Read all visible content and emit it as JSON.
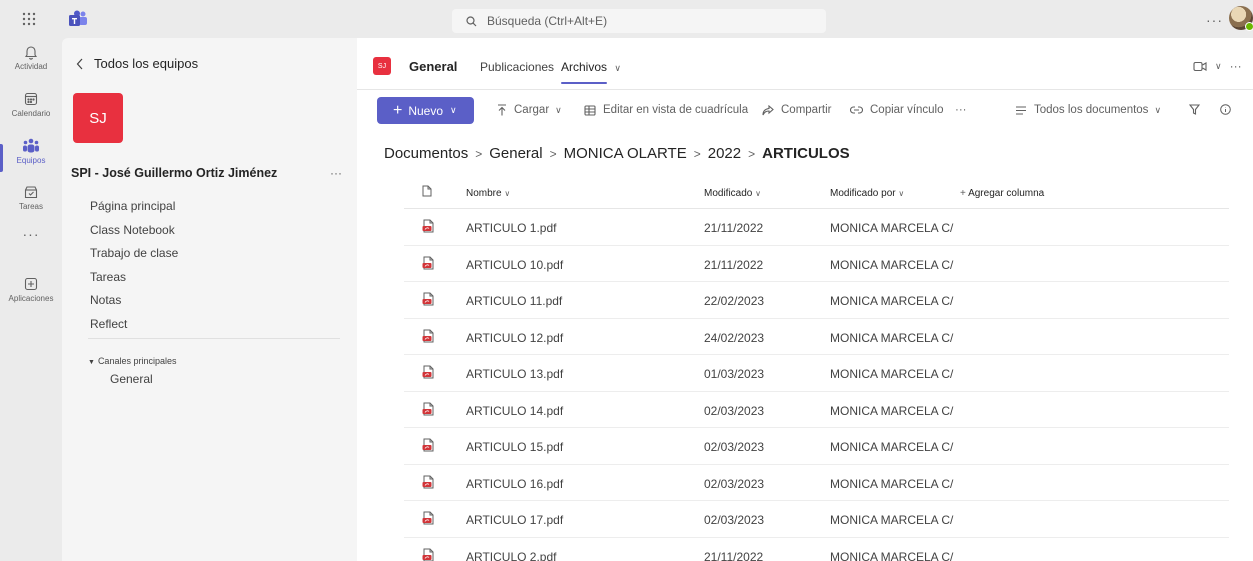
{
  "search": {
    "placeholder": "Búsqueda (Ctrl+Alt+E)"
  },
  "topbar": {
    "more": "···"
  },
  "rail": {
    "items": [
      {
        "label": "Actividad",
        "icon": "bell-icon"
      },
      {
        "label": "Calendario",
        "icon": "calendar-icon"
      },
      {
        "label": "Equipos",
        "icon": "teams-icon"
      },
      {
        "label": "Tareas",
        "icon": "tasks-icon"
      },
      {
        "label": "",
        "icon": "more-icon",
        "glyph": "···"
      },
      {
        "label": "Aplicaciones",
        "icon": "add-apps-icon"
      }
    ]
  },
  "team": {
    "back_label": "Todos los equipos",
    "tile_initials": "SJ",
    "name": "SPI - José Guillermo Ortiz Jiménez",
    "more": "···",
    "nav": [
      "Página principal",
      "Class Notebook",
      "Trabajo de clase",
      "Tareas",
      "Notas",
      "Reflect"
    ],
    "channels_heading": "Canales principales",
    "channels": [
      "General"
    ]
  },
  "channel": {
    "tile_initials": "SJ",
    "name": "General",
    "tabs": [
      "Publicaciones",
      "Archivos"
    ],
    "active_tab": "Archivos",
    "more": "···"
  },
  "toolbar": {
    "new_label": "Nuevo",
    "upload_label": "Cargar",
    "grid_label": "Editar en vista de cuadrícula",
    "share_label": "Compartir",
    "copy_link_label": "Copiar vínculo",
    "more": "···",
    "view_label": "Todos los documentos"
  },
  "breadcrumb": [
    "Documentos",
    "General",
    "MONICA OLARTE",
    "2022",
    "ARTICULOS"
  ],
  "table": {
    "columns": {
      "name": "Nombre",
      "modified": "Modificado",
      "modified_by": "Modificado por",
      "add_column": "Agregar columna"
    },
    "rows": [
      {
        "name": "ARTICULO 1.pdf",
        "modified": "21/11/2022",
        "modified_by": "MONICA MARCELA C/"
      },
      {
        "name": "ARTICULO 10.pdf",
        "modified": "21/11/2022",
        "modified_by": "MONICA MARCELA C/"
      },
      {
        "name": "ARTICULO 11.pdf",
        "modified": "22/02/2023",
        "modified_by": "MONICA MARCELA C/"
      },
      {
        "name": "ARTICULO 12.pdf",
        "modified": "24/02/2023",
        "modified_by": "MONICA MARCELA C/"
      },
      {
        "name": "ARTICULO 13.pdf",
        "modified": "01/03/2023",
        "modified_by": "MONICA MARCELA C/"
      },
      {
        "name": "ARTICULO 14.pdf",
        "modified": "02/03/2023",
        "modified_by": "MONICA MARCELA C/"
      },
      {
        "name": "ARTICULO 15.pdf",
        "modified": "02/03/2023",
        "modified_by": "MONICA MARCELA C/"
      },
      {
        "name": "ARTICULO 16.pdf",
        "modified": "02/03/2023",
        "modified_by": "MONICA MARCELA C/"
      },
      {
        "name": "ARTICULO 17.pdf",
        "modified": "02/03/2023",
        "modified_by": "MONICA MARCELA C/"
      },
      {
        "name": "ARTICULO 2.pdf",
        "modified": "21/11/2022",
        "modified_by": "MONICA MARCELA C/"
      }
    ]
  },
  "colors": {
    "accent": "#5b5fc7",
    "team_tile": "#e8303f",
    "pdf_icon": "#d13438"
  }
}
